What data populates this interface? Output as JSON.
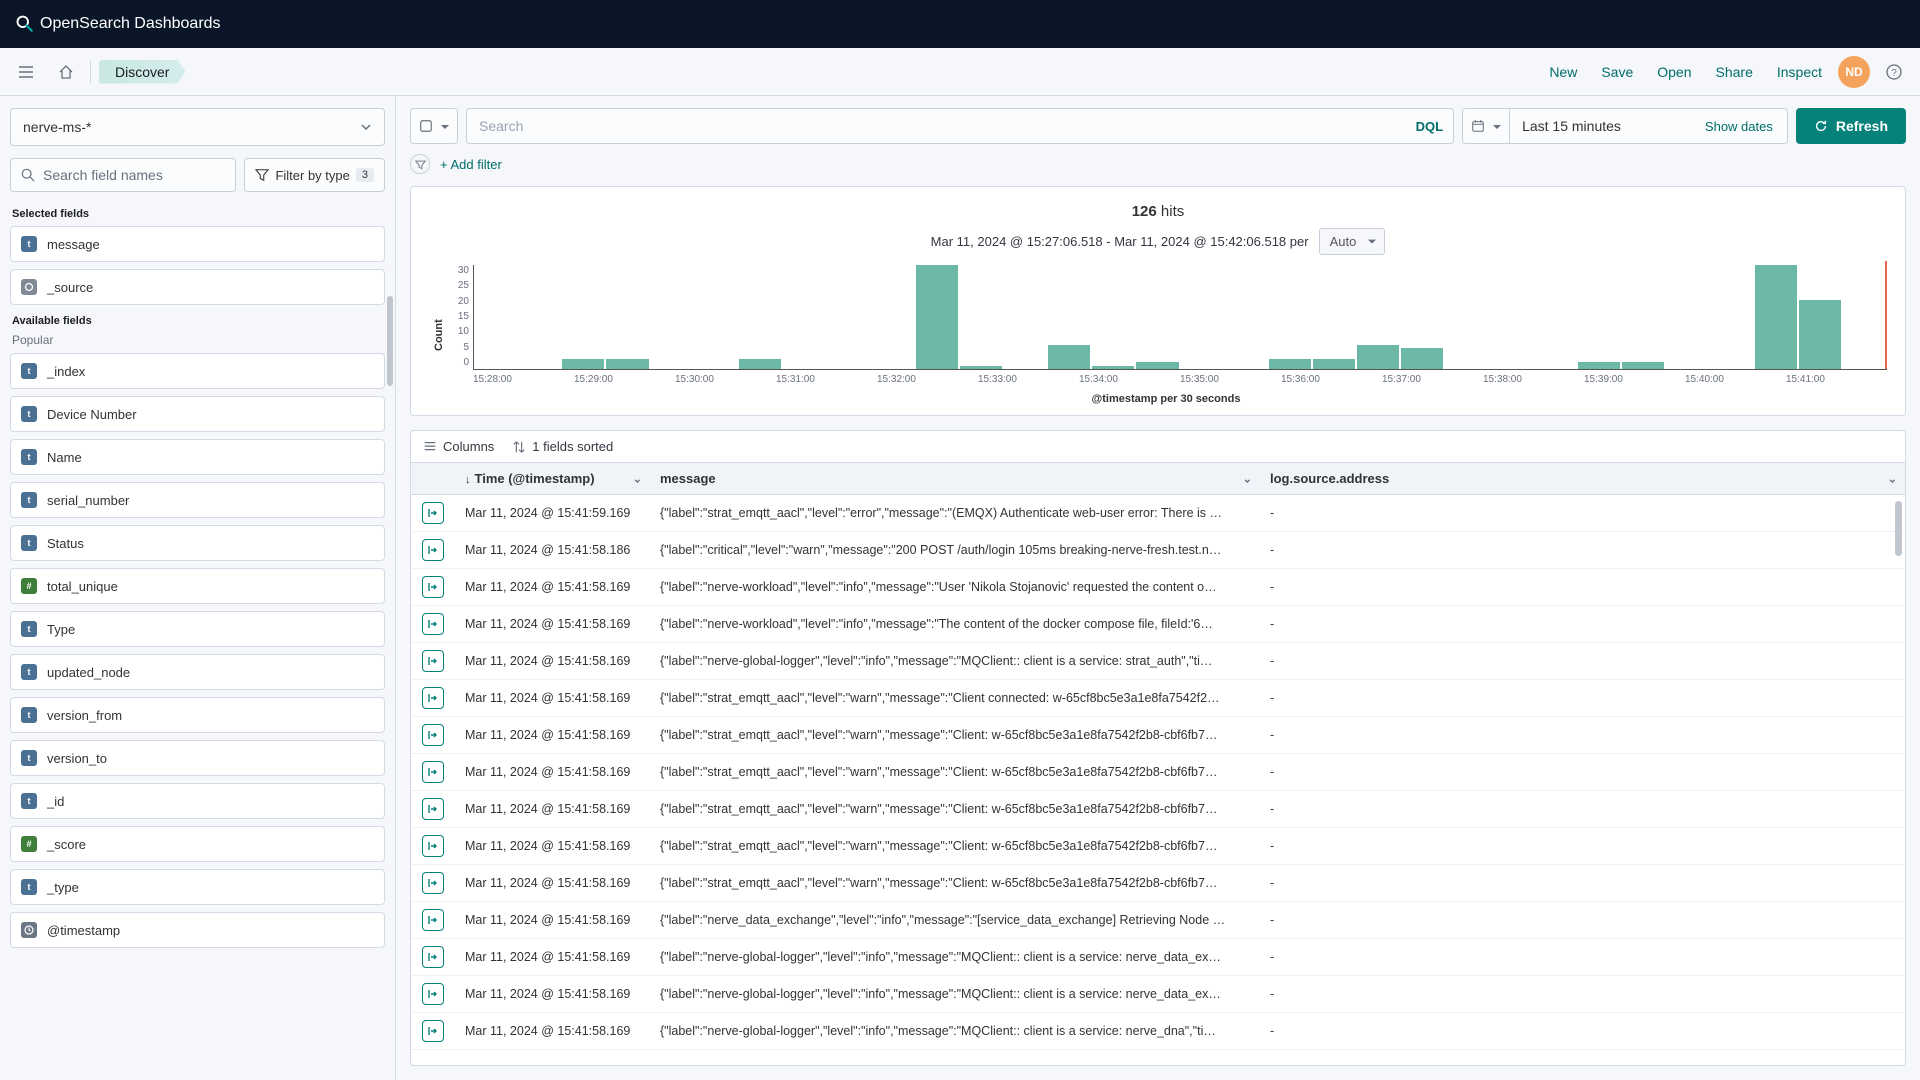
{
  "brand": {
    "name": "OpenSearch Dashboards"
  },
  "breadcrumb": "Discover",
  "toolbar": {
    "new": "New",
    "save": "Save",
    "open": "Open",
    "share": "Share",
    "inspect": "Inspect",
    "avatar": "ND"
  },
  "sidebar": {
    "index_pattern": "nerve-ms-*",
    "search_placeholder": "Search field names",
    "filter_by_type": "Filter by type",
    "filter_count": "3",
    "selected_label": "Selected fields",
    "available_label": "Available fields",
    "popular_label": "Popular",
    "selected": [
      {
        "type": "t",
        "name": "message"
      },
      {
        "type": "src",
        "name": "_source"
      }
    ],
    "available": [
      {
        "type": "t",
        "name": "_index"
      },
      {
        "type": "t",
        "name": "Device Number"
      },
      {
        "type": "t",
        "name": "Name"
      },
      {
        "type": "t",
        "name": "serial_number"
      },
      {
        "type": "t",
        "name": "Status"
      },
      {
        "type": "num",
        "name": "total_unique"
      },
      {
        "type": "t",
        "name": "Type"
      },
      {
        "type": "t",
        "name": "updated_node"
      },
      {
        "type": "t",
        "name": "version_from"
      },
      {
        "type": "t",
        "name": "version_to"
      },
      {
        "type": "t",
        "name": "_id"
      },
      {
        "type": "num",
        "name": "_score"
      },
      {
        "type": "t",
        "name": "_type"
      },
      {
        "type": "clock",
        "name": "@timestamp"
      }
    ]
  },
  "query": {
    "search_placeholder": "Search",
    "dql": "DQL",
    "time_range": "Last 15 minutes",
    "show_dates": "Show dates",
    "refresh": "Refresh"
  },
  "filters": {
    "add": "+ Add filter"
  },
  "histogram": {
    "hits": "126",
    "hits_label": "hits",
    "range_text": "Mar 11, 2024 @ 15:27:06.518 - Mar 11, 2024 @ 15:42:06.518 per",
    "interval": "Auto",
    "y_label": "Count",
    "x_label": "@timestamp per 30 seconds"
  },
  "chart_data": {
    "type": "bar",
    "ylabel": "Count",
    "xlabel": "@timestamp per 30 seconds",
    "ylim": [
      0,
      30
    ],
    "y_ticks": [
      "30",
      "25",
      "20",
      "15",
      "10",
      "5",
      "0"
    ],
    "x_ticks": [
      "15:28:00",
      "15:29:00",
      "15:30:00",
      "15:31:00",
      "15:32:00",
      "15:33:00",
      "15:34:00",
      "15:35:00",
      "15:36:00",
      "15:37:00",
      "15:38:00",
      "15:39:00",
      "15:40:00",
      "15:41:00"
    ],
    "values": [
      0,
      0,
      3,
      3,
      0,
      0,
      3,
      0,
      0,
      0,
      30,
      1,
      0,
      7,
      1,
      2,
      0,
      0,
      3,
      3,
      7,
      6,
      0,
      0,
      0,
      2,
      2,
      0,
      0,
      30,
      20,
      0
    ]
  },
  "table": {
    "columns_btn": "Columns",
    "sort_btn": "1 fields sorted",
    "cols": {
      "time": "Time (@timestamp)",
      "message": "message",
      "addr": "log.source.address"
    },
    "rows": [
      {
        "t": "Mar 11, 2024 @ 15:41:59.169",
        "m": "{\"label\":\"strat_emqtt_aacl\",\"level\":\"error\",\"message\":\"(EMQX) Authenticate web-user error: There is …",
        "a": "-"
      },
      {
        "t": "Mar 11, 2024 @ 15:41:58.186",
        "m": "{\"label\":\"critical\",\"level\":\"warn\",\"message\":\"200 POST /auth/login 105ms breaking-nerve-fresh.test.n…",
        "a": "-"
      },
      {
        "t": "Mar 11, 2024 @ 15:41:58.169",
        "m": "{\"label\":\"nerve-workload\",\"level\":\"info\",\"message\":\"User 'Nikola Stojanovic' requested the content o…",
        "a": "-"
      },
      {
        "t": "Mar 11, 2024 @ 15:41:58.169",
        "m": "{\"label\":\"nerve-workload\",\"level\":\"info\",\"message\":\"The content of the docker compose file, fileId:'6…",
        "a": "-"
      },
      {
        "t": "Mar 11, 2024 @ 15:41:58.169",
        "m": "{\"label\":\"nerve-global-logger\",\"level\":\"info\",\"message\":\"MQClient:: client is a service: strat_auth\",\"ti…",
        "a": "-"
      },
      {
        "t": "Mar 11, 2024 @ 15:41:58.169",
        "m": "{\"label\":\"strat_emqtt_aacl\",\"level\":\"warn\",\"message\":\"Client connected: w-65cf8bc5e3a1e8fa7542f2…",
        "a": "-"
      },
      {
        "t": "Mar 11, 2024 @ 15:41:58.169",
        "m": "{\"label\":\"strat_emqtt_aacl\",\"level\":\"warn\",\"message\":\"Client: w-65cf8bc5e3a1e8fa7542f2b8-cbf6fb7…",
        "a": "-"
      },
      {
        "t": "Mar 11, 2024 @ 15:41:58.169",
        "m": "{\"label\":\"strat_emqtt_aacl\",\"level\":\"warn\",\"message\":\"Client: w-65cf8bc5e3a1e8fa7542f2b8-cbf6fb7…",
        "a": "-"
      },
      {
        "t": "Mar 11, 2024 @ 15:41:58.169",
        "m": "{\"label\":\"strat_emqtt_aacl\",\"level\":\"warn\",\"message\":\"Client: w-65cf8bc5e3a1e8fa7542f2b8-cbf6fb7…",
        "a": "-"
      },
      {
        "t": "Mar 11, 2024 @ 15:41:58.169",
        "m": "{\"label\":\"strat_emqtt_aacl\",\"level\":\"warn\",\"message\":\"Client: w-65cf8bc5e3a1e8fa7542f2b8-cbf6fb7…",
        "a": "-"
      },
      {
        "t": "Mar 11, 2024 @ 15:41:58.169",
        "m": "{\"label\":\"strat_emqtt_aacl\",\"level\":\"warn\",\"message\":\"Client: w-65cf8bc5e3a1e8fa7542f2b8-cbf6fb7…",
        "a": "-"
      },
      {
        "t": "Mar 11, 2024 @ 15:41:58.169",
        "m": "{\"label\":\"nerve_data_exchange\",\"level\":\"info\",\"message\":\"[service_data_exchange] Retrieving Node …",
        "a": "-"
      },
      {
        "t": "Mar 11, 2024 @ 15:41:58.169",
        "m": "{\"label\":\"nerve-global-logger\",\"level\":\"info\",\"message\":\"MQClient:: client is a service: nerve_data_ex…",
        "a": "-"
      },
      {
        "t": "Mar 11, 2024 @ 15:41:58.169",
        "m": "{\"label\":\"nerve-global-logger\",\"level\":\"info\",\"message\":\"MQClient:: client is a service: nerve_data_ex…",
        "a": "-"
      },
      {
        "t": "Mar 11, 2024 @ 15:41:58.169",
        "m": "{\"label\":\"nerve-global-logger\",\"level\":\"info\",\"message\":\"MQClient:: client is a service: nerve_dna\",\"ti…",
        "a": "-"
      }
    ]
  }
}
